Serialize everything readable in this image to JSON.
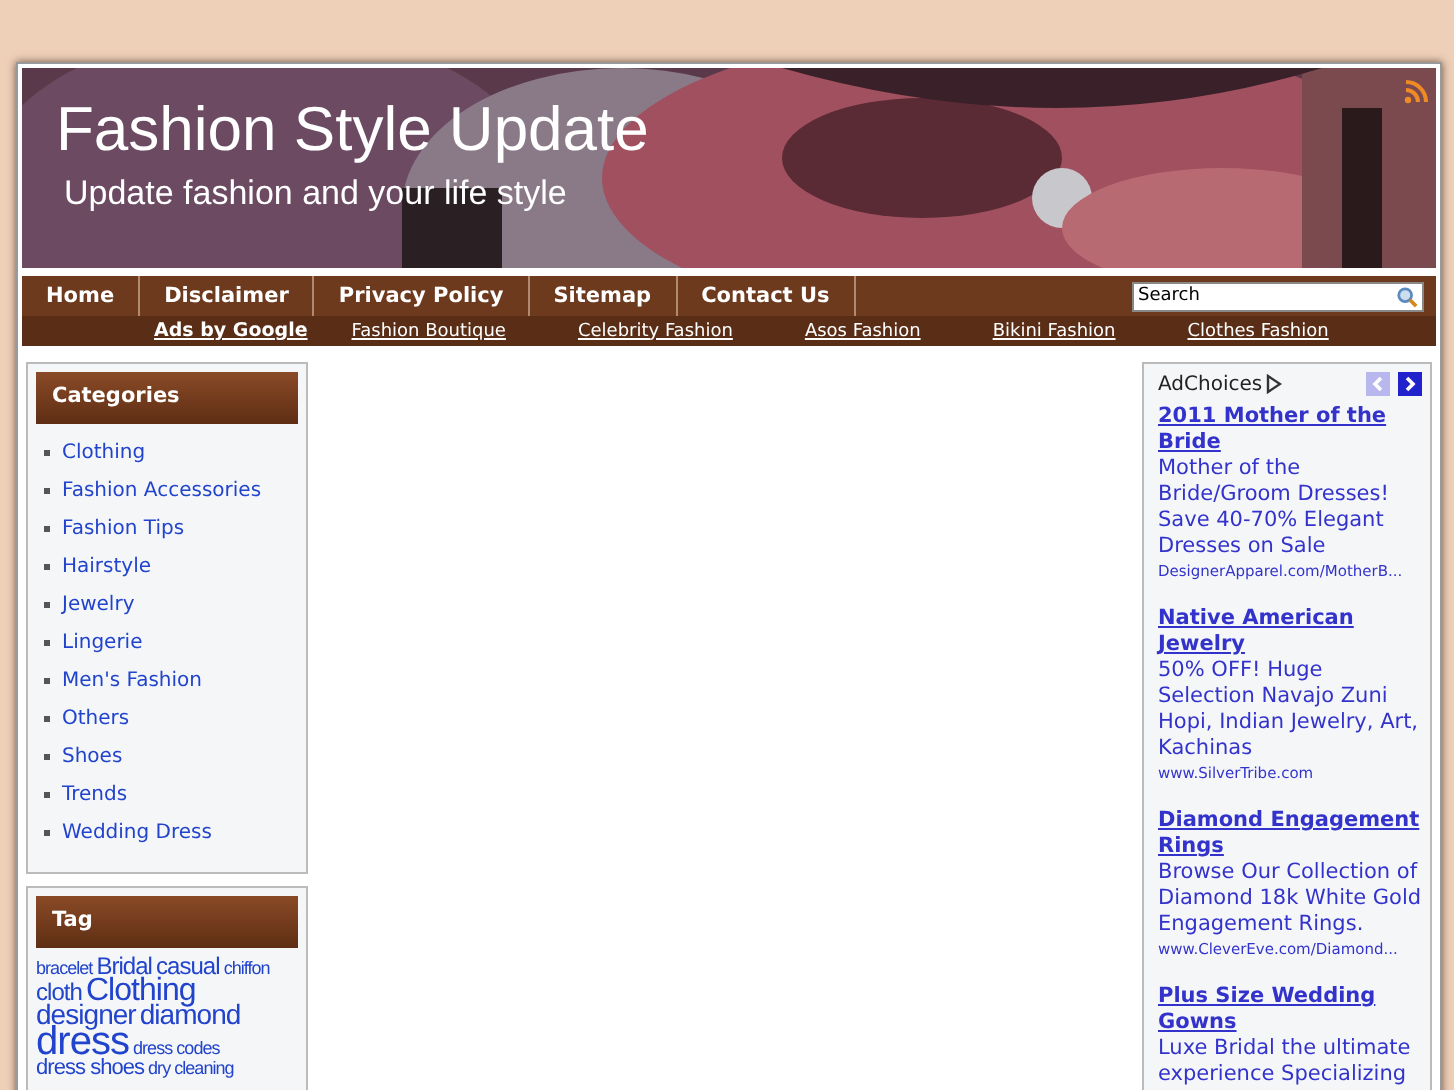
{
  "header": {
    "title": "Fashion Style Update",
    "tagline": "Update fashion and your life style"
  },
  "nav": [
    {
      "label": "Home"
    },
    {
      "label": "Disclaimer"
    },
    {
      "label": "Privacy Policy"
    },
    {
      "label": "Sitemap"
    },
    {
      "label": "Contact Us"
    }
  ],
  "search": {
    "value": "Search"
  },
  "ad_links": {
    "label": "Ads by Google",
    "links": [
      "Fashion Boutique",
      "Celebrity Fashion",
      "Asos Fashion",
      "Bikini Fashion",
      "Clothes Fashion"
    ]
  },
  "categories": {
    "title": "Categories",
    "items": [
      "Clothing",
      "Fashion Accessories",
      "Fashion Tips",
      "Hairstyle",
      "Jewelry",
      "Lingerie",
      "Men's Fashion",
      "Others",
      "Shoes",
      "Trends",
      "Wedding Dress"
    ]
  },
  "tags": {
    "title": "Tag",
    "items": [
      {
        "label": "bracelet",
        "kind": "s"
      },
      {
        "label": "Bridal",
        "kind": "m"
      },
      {
        "label": "casual",
        "kind": "m"
      },
      {
        "label": "chiffon",
        "kind": "s"
      },
      {
        "label": "cloth",
        "kind": "m"
      },
      {
        "label": "Clothing",
        "kind": "xl"
      },
      {
        "label": "designer",
        "kind": "l"
      },
      {
        "label": "diamond",
        "kind": "l"
      },
      {
        "label": "dress",
        "kind": "xxl"
      },
      {
        "label": "dress codes",
        "kind": "s"
      },
      {
        "label": "dress shoes",
        "kind": "ms"
      },
      {
        "label": "dry cleaning",
        "kind": "s"
      }
    ]
  },
  "ads": {
    "label": "AdChoices",
    "items": [
      {
        "title": "2011 Mother of the Bride",
        "text": "Mother of the Bride/Groom Dresses! Save 40-70% Elegant Dresses on Sale",
        "url": "DesignerApparel.com/MotherB..."
      },
      {
        "title": "Native American Jewelry",
        "text": "50% OFF! Huge Selection Navajo Zuni Hopi, Indian Jewelry, Art, Kachinas",
        "url": "www.SilverTribe.com"
      },
      {
        "title": "Diamond Engagement Rings",
        "text": "Browse Our Collection of Diamond 18k White Gold Engagement Rings.",
        "url": "www.CleverEve.com/Diamond..."
      },
      {
        "title": "Plus Size Wedding Gowns",
        "text": "Luxe Bridal the ultimate experience Specializing"
      }
    ]
  }
}
